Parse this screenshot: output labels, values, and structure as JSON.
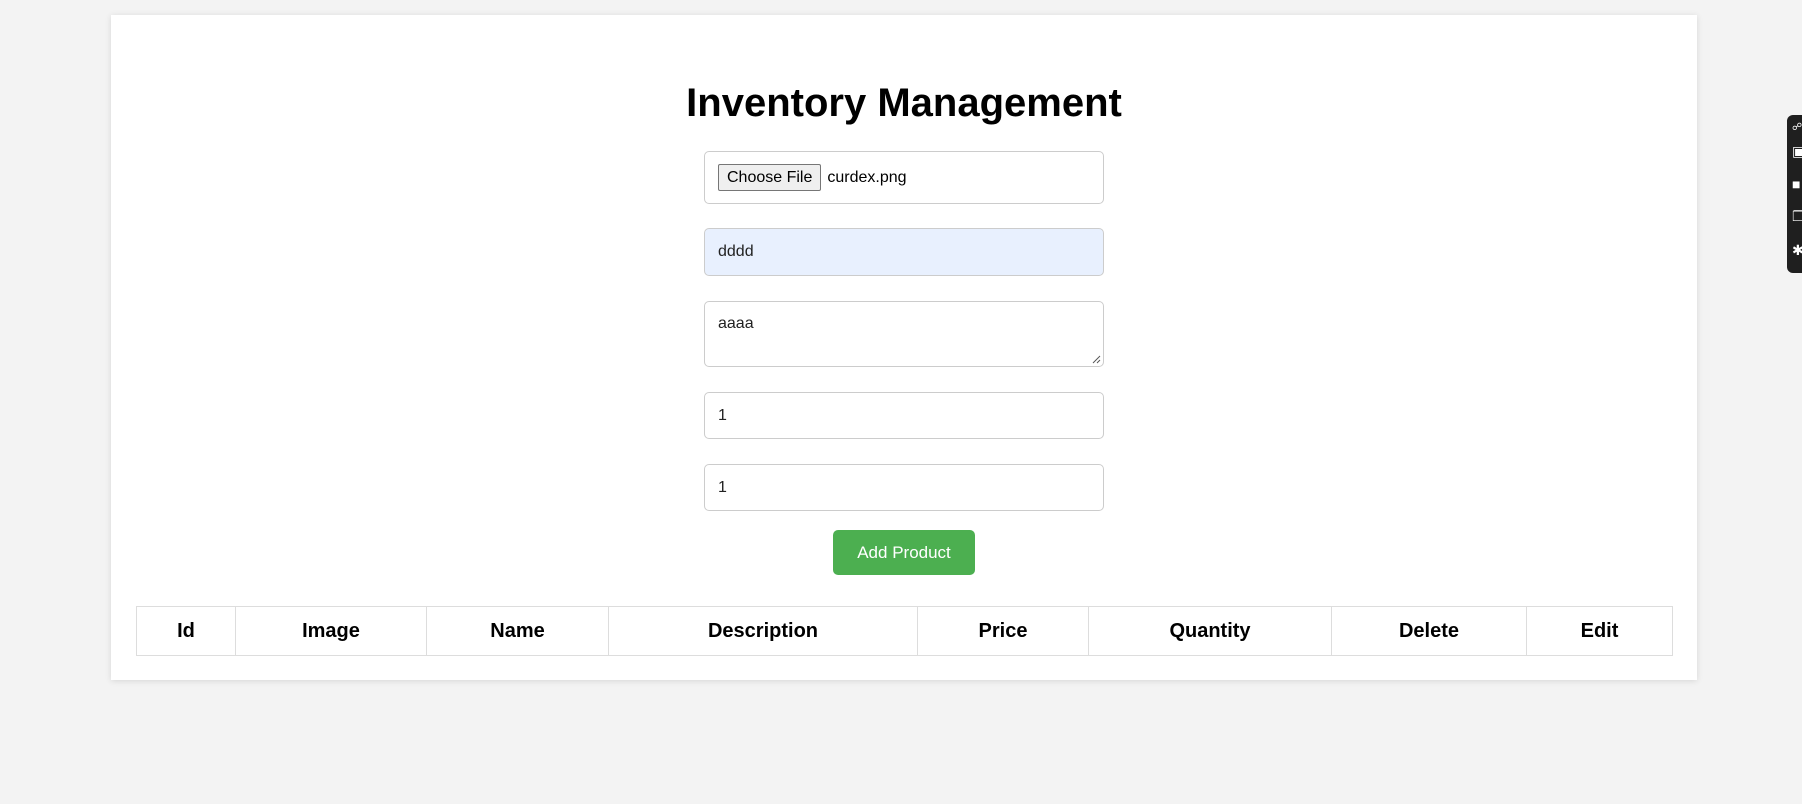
{
  "page": {
    "title": "Inventory Management"
  },
  "form": {
    "choose_file_label": "Choose File",
    "file_name": "curdex.png",
    "name_value": "dddd",
    "description_value": "aaaa",
    "price_value": "1",
    "quantity_value": "1",
    "add_button_label": "Add Product"
  },
  "table": {
    "headers": [
      "Id",
      "Image",
      "Name",
      "Description",
      "Price",
      "Quantity",
      "Delete",
      "Edit"
    ]
  },
  "colors": {
    "accent_button": "#4caf50",
    "autofill_background": "#e8f0fe",
    "page_background": "#f3f3f3"
  },
  "side_toolbar": {
    "icons": [
      "link-icon",
      "camera-icon",
      "square-icon",
      "copy-icon",
      "gear-icon"
    ]
  }
}
